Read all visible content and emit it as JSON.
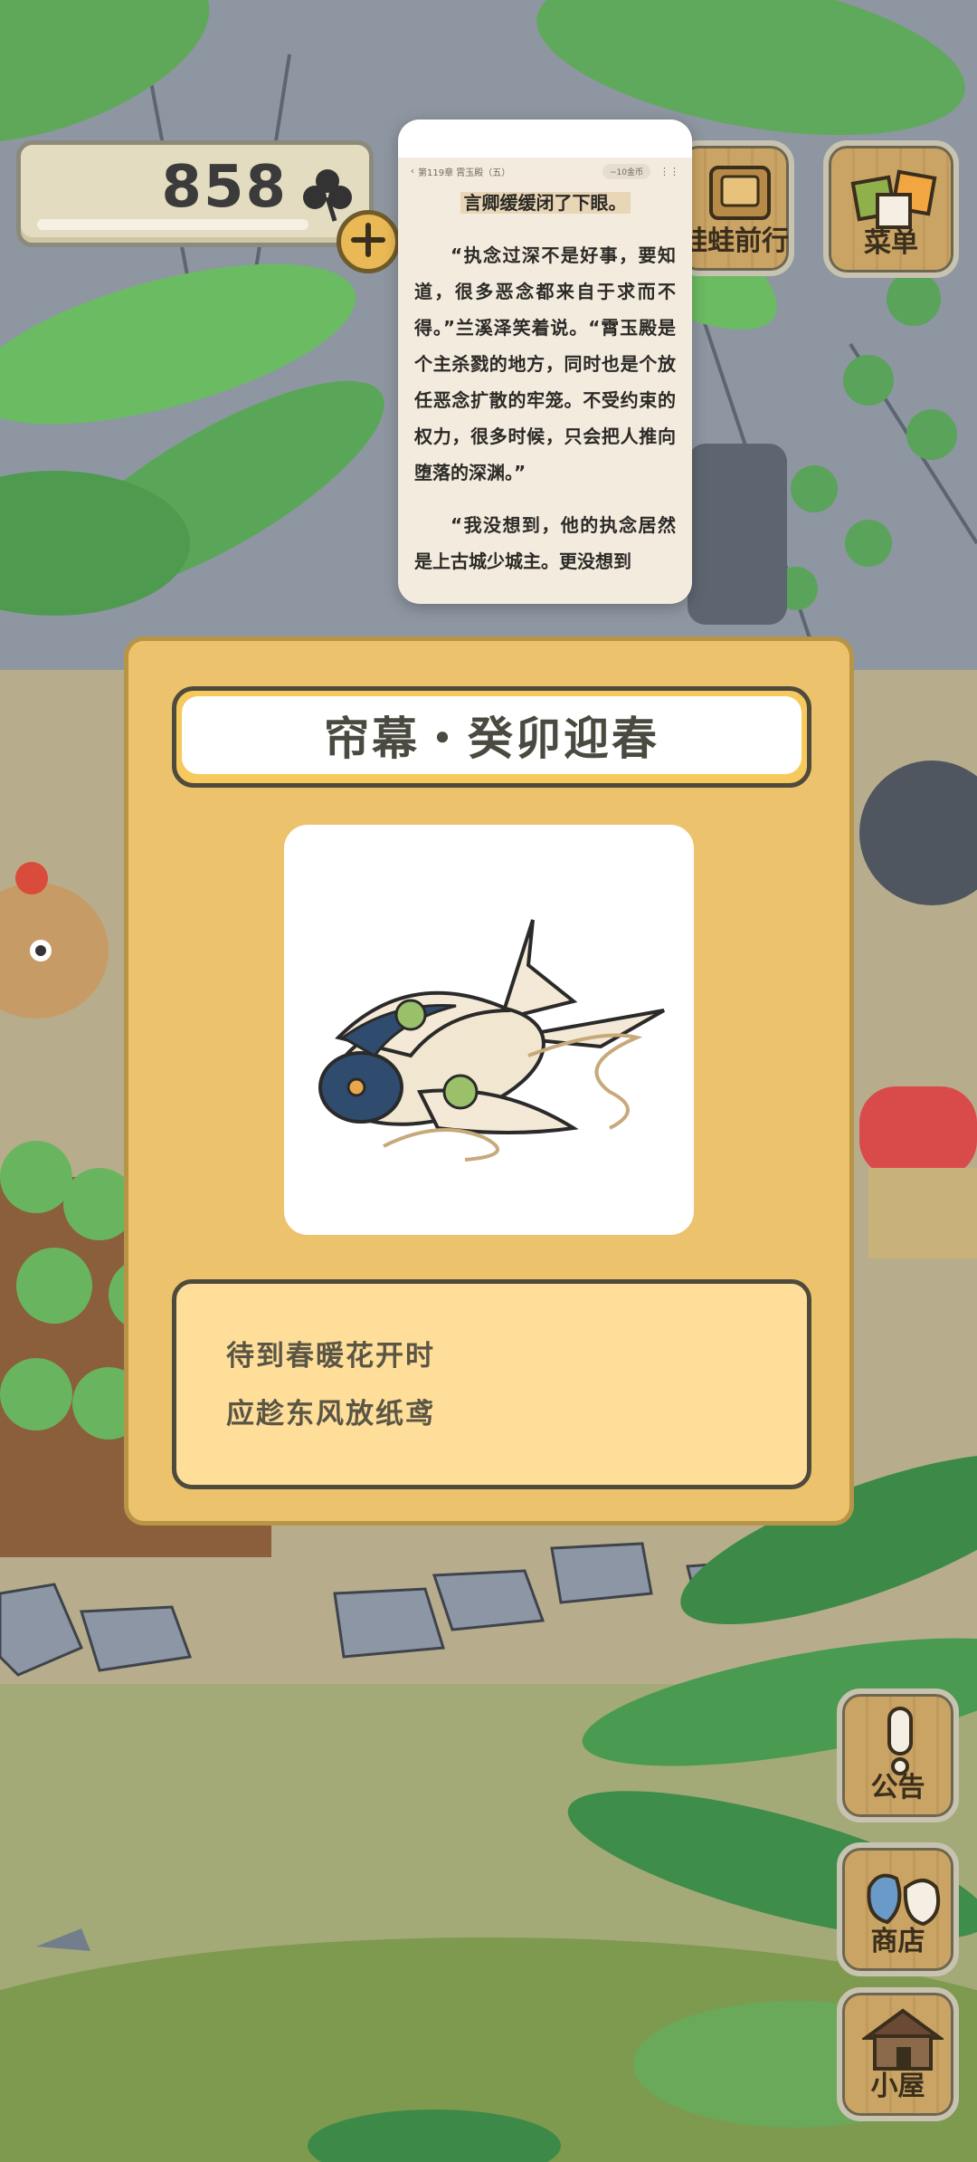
{
  "counter": {
    "clover_count": "858"
  },
  "top_buttons": {
    "frog_trip": "蛙蛙前行",
    "menu": "菜单"
  },
  "side_buttons": {
    "notice": "公告",
    "shop": "商店",
    "house": "小屋"
  },
  "reader": {
    "chapter": "第119章 霄玉殿（五）",
    "coin_pill": "~10金币",
    "paragraphs": [
      "言卿缓缓闭了下眼。",
      "“执念过深不是好事，要知道，很多恶念都来自于求而不得。”兰溪泽笑着说。“霄玉殿是个主杀戮的地方，同时也是个放任恶念扩散的牢笼。不受约束的权力，很多时候，只会把人推向堕落的深渊。”",
      "“我没想到，他的执念居然是上古城少城主。更没想到"
    ]
  },
  "item": {
    "title": "帘幕・癸卯迎春",
    "desc_line1": "待到春暖花开时",
    "desc_line2": "应趁东风放纸鸢"
  },
  "colors": {
    "dialog_bg": "#ecc36c",
    "desc_bg": "#fede99",
    "title_text": "#4a4a40"
  },
  "icons": {
    "clover": "clover-icon",
    "add": "plus-icon",
    "notice": "exclamation-icon",
    "shop": "bag-icon",
    "house": "house-icon",
    "menu": "menu-cards-icon",
    "frog_trip": "book-icon"
  }
}
